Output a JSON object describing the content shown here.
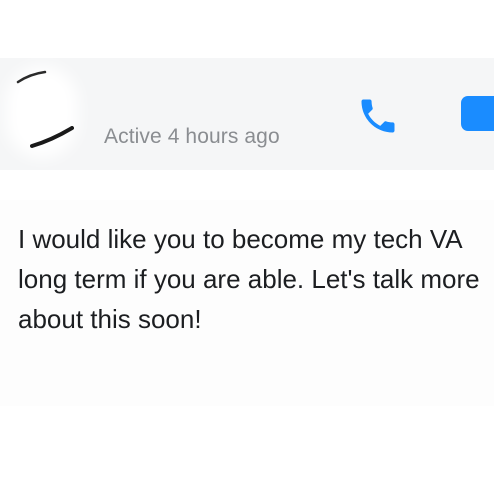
{
  "conversation": {
    "status": "Active 4 hours ago",
    "actions": {
      "call_icon": "phone-icon",
      "video_icon": "video-camera-icon",
      "accent_color": "#1a8cff"
    }
  },
  "message": {
    "text": "I would like you to become my tech VA long term if you are able. Let's talk more about this soon!"
  }
}
